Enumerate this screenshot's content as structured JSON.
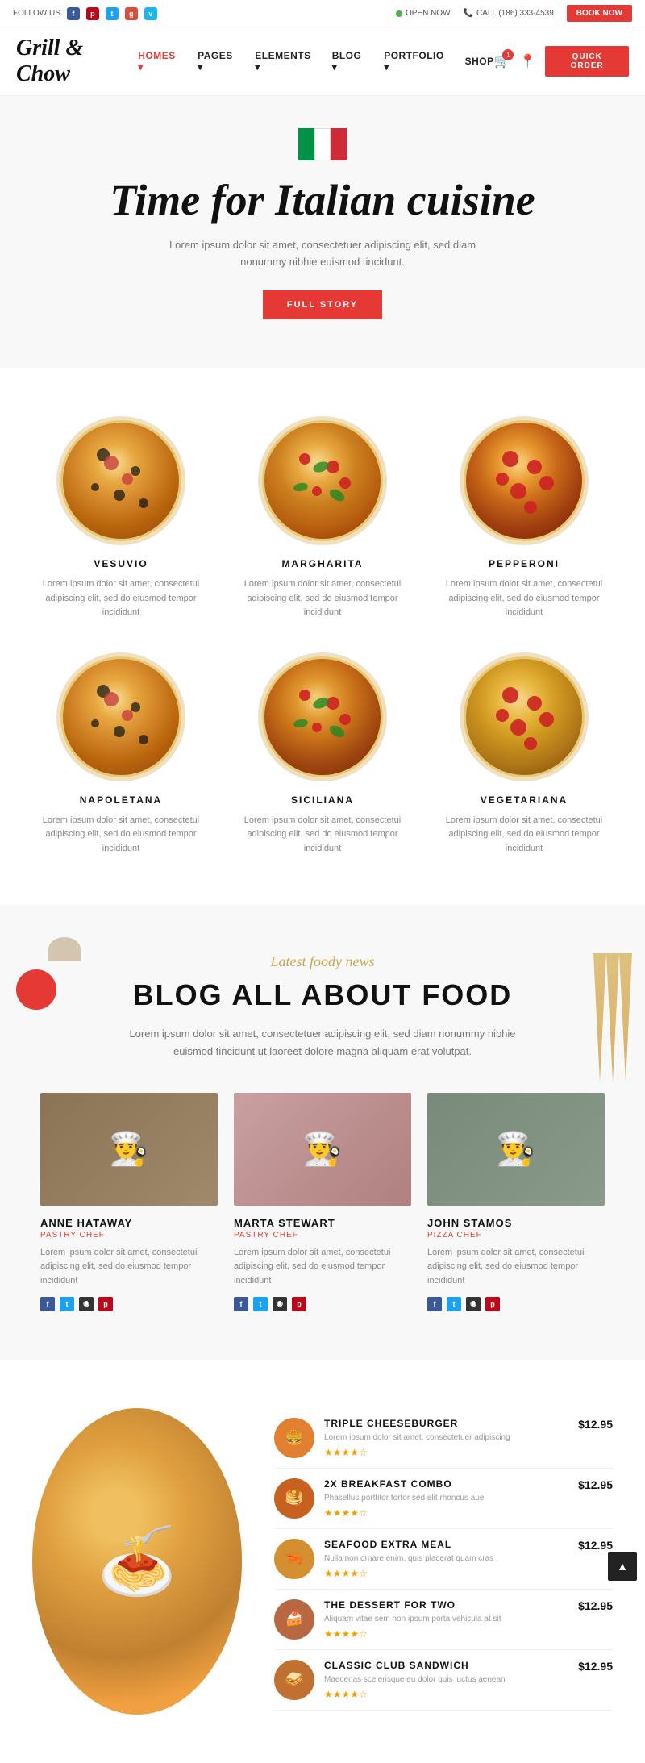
{
  "topbar": {
    "follow_label": "FOLLOW US",
    "social_icons": [
      "f",
      "p",
      "t",
      "g+",
      "v"
    ],
    "open_now": "OPEN NOW",
    "phone": "CALL (186) 333-4539",
    "book_now": "BOOK NOW"
  },
  "nav": {
    "logo": "Grill & Chow",
    "links": [
      {
        "label": "HOMES",
        "active": true
      },
      {
        "label": "PAGES"
      },
      {
        "label": "ELEMENTS"
      },
      {
        "label": "BLOG"
      },
      {
        "label": "PORTFOLIO"
      },
      {
        "label": "SHOP"
      }
    ],
    "cart_count": "1",
    "quick_order": "QUICK ORDER"
  },
  "hero": {
    "title": "Time for Italian cuisine",
    "subtitle": "Lorem ipsum dolor sit amet, consectetuer adipiscing elit, sed diam nonummy nibhie euismod tincidunt.",
    "button": "FULL STORY"
  },
  "pizzas": [
    {
      "name": "VESUVIO",
      "desc": "Lorem ipsum dolor sit amet, consectetui adipiscing elit, sed do eiusmod tempor incididunt",
      "type": "vesuvio"
    },
    {
      "name": "MARGHARITA",
      "desc": "Lorem ipsum dolor sit amet, consectetui adipiscing elit, sed do eiusmod tempor incididunt",
      "type": "margherita"
    },
    {
      "name": "PEPPERONI",
      "desc": "Lorem ipsum dolor sit amet, consectetui adipiscing elit, sed do eiusmod tempor incididunt",
      "type": "pepperoni"
    },
    {
      "name": "NAPOLETANA",
      "desc": "Lorem ipsum dolor sit amet, consectetui adipiscing elit, sed do eiusmod tempor incididunt",
      "type": "napoletana"
    },
    {
      "name": "SICILIANA",
      "desc": "Lorem ipsum dolor sit amet, consectetui adipiscing elit, sed do eiusmod tempor incididunt",
      "type": "siciliana"
    },
    {
      "name": "VEGETARIANA",
      "desc": "Lorem ipsum dolor sit amet, consectetui adipiscing elit, sed do eiusmod tempor incididunt",
      "type": "vegetariana"
    }
  ],
  "blog": {
    "label": "Latest foody news",
    "title": "BLOG ALL ABOUT FOOD",
    "desc": "Lorem ipsum dolor sit amet, consectetuer adipiscing elit, sed diam nonummy nibhie euismod tincidunt ut laoreet dolore magna aliquam erat volutpat.",
    "chefs": [
      {
        "name": "ANNE HATAWAY",
        "role": "PASTRY CHEF",
        "desc": "Lorem ipsum dolor sit amet, consectetui adipiscing elit, sed do eiusmod tempor incididunt",
        "social": [
          "f",
          "t",
          "i",
          "p"
        ],
        "photo_class": "photo-anne"
      },
      {
        "name": "MARTA STEWART",
        "role": "PASTRY CHEF",
        "desc": "Lorem ipsum dolor sit amet, consectetui adipiscing elit, sed do eiusmod tempor incididunt",
        "social": [
          "f",
          "t",
          "i",
          "p"
        ],
        "photo_class": "photo-marta"
      },
      {
        "name": "JOHN STAMOS",
        "role": "PIZZA CHEF",
        "desc": "Lorem ipsum dolor sit amet, consectetui adipiscing elit, sed do eiusmod tempor incididunt",
        "social": [
          "f",
          "t",
          "i",
          "p"
        ],
        "photo_class": "photo-john"
      }
    ]
  },
  "menu": {
    "items": [
      {
        "name": "TRIPLE CHEESEBURGER",
        "desc": "Lorem ipsum dolor sit amet, consectetuer adipiscing",
        "price": "$12.95",
        "stars": 4
      },
      {
        "name": "2X BREAKFAST COMBO",
        "desc": "Phasellus porttitor tortor sed elit rhoncus aue",
        "price": "$12.95",
        "stars": 4
      },
      {
        "name": "SEAFOOD EXTRA MEAL",
        "desc": "Nulla non ornare enim, quis placerat quam cras",
        "price": "$12.95",
        "stars": 4
      },
      {
        "name": "THE DESSERT FOR TWO",
        "desc": "Aliquam vitae sem non ipsum porta vehicula at sit",
        "price": "$12.95",
        "stars": 4
      },
      {
        "name": "CLASSIC CLUB SANDWICH",
        "desc": "Maecenas scelerisque eu dolor quis luctus aenean",
        "price": "$12.95",
        "stars": 4
      }
    ]
  }
}
